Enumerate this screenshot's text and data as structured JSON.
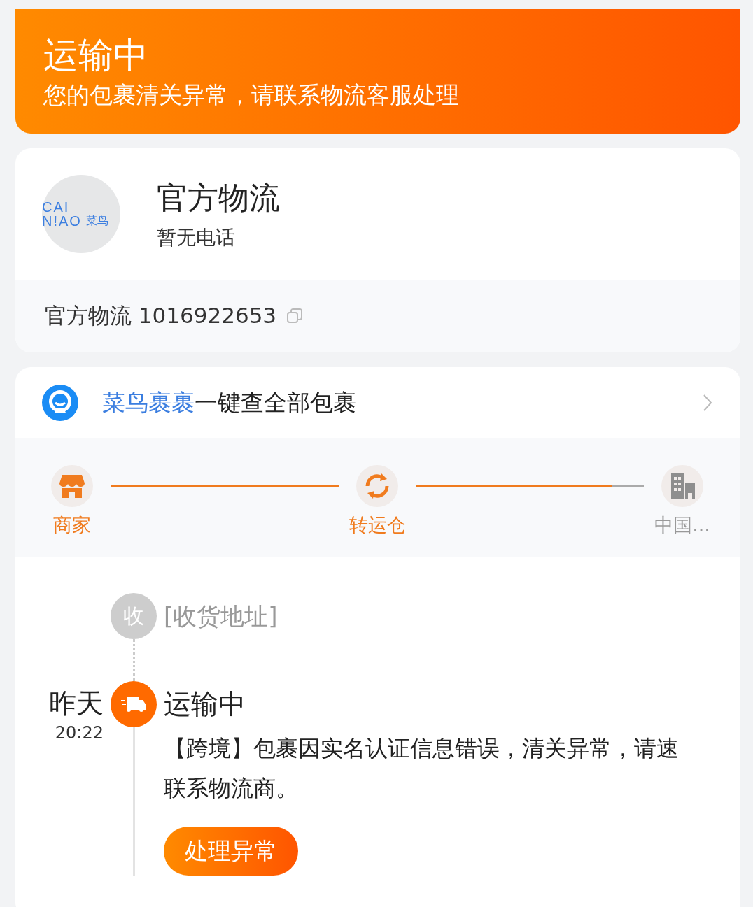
{
  "header": {
    "title": "运输中",
    "subtitle": "您的包裹清关异常，请联系物流客服处理"
  },
  "carrier": {
    "logo_lines": [
      "CAI",
      "N!AO",
      "菜鸟"
    ],
    "name": "官方物流",
    "phone": "暂无电话",
    "tracking": "官方物流 1016922653"
  },
  "promo": {
    "link": "菜鸟裹裹",
    "text": "一键查全部包裹"
  },
  "progress": {
    "steps": [
      {
        "kind": "shop",
        "label": "商家",
        "active": true
      },
      {
        "kind": "transfer",
        "label": "转运仓",
        "active": true
      },
      {
        "kind": "city",
        "label": "中国...",
        "active": false
      }
    ],
    "segments": [
      {
        "level": 1
      },
      {
        "level": 0.86
      }
    ]
  },
  "timeline": [
    {
      "kind": "address",
      "badge": "收",
      "title": "[收货地址]"
    },
    {
      "kind": "status",
      "day": "昨天",
      "time": "20:22",
      "title": "运输中",
      "description": "【跨境】包裹因实名认证信息错误，清关异常，请速联系物流商。",
      "action": "处理异常"
    }
  ]
}
